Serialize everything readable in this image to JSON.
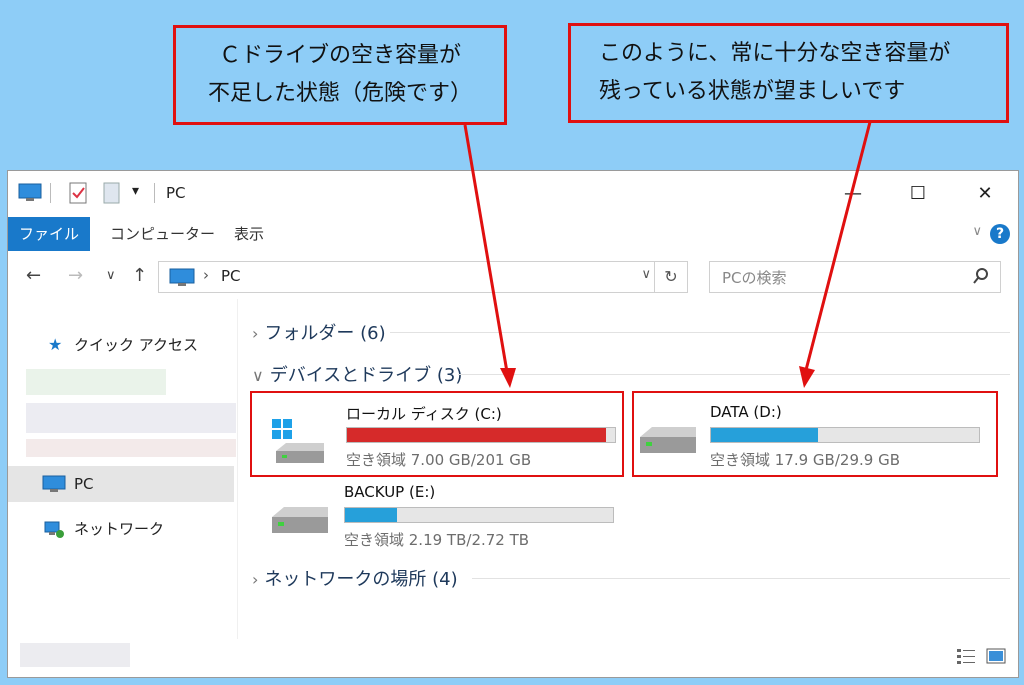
{
  "callouts": {
    "left": [
      "Ｃドライブの空き容量が",
      "不足した状態（危険です）"
    ],
    "right": [
      "このように、常に十分な空き容量が",
      "残っている状態が望ましいです"
    ]
  },
  "window": {
    "title": "PC",
    "minimize": "—",
    "maximize": "☐",
    "close": "✕"
  },
  "ribbon": {
    "tabs": [
      "ファイル",
      "コンピューター",
      "表示"
    ],
    "help": "?"
  },
  "address": {
    "path": "PC",
    "separator": "›",
    "search_placeholder": "PCの検索"
  },
  "sidebar": {
    "items": [
      {
        "label": "クイック アクセス",
        "icon": "star-icon"
      },
      {
        "label": "PC",
        "icon": "pc-icon",
        "selected": true
      },
      {
        "label": "ネットワーク",
        "icon": "network-icon"
      }
    ]
  },
  "groups": {
    "folders": "フォルダー (6)",
    "devices": "デバイスとドライブ (3)",
    "network": "ネットワークの場所 (4)"
  },
  "drives": [
    {
      "name": "ローカル ディスク (C:)",
      "free_text": "空き領域 7.00 GB/201 GB",
      "used_fraction": 0.965,
      "bar_color": "#d62a2a",
      "icon": "windows-drive-icon"
    },
    {
      "name": "DATA (D:)",
      "free_text": "空き領域 17.9 GB/29.9 GB",
      "used_fraction": 0.4,
      "bar_color": "#26a0da",
      "icon": "hdd-icon"
    },
    {
      "name": "BACKUP (E:)",
      "free_text": "空き領域 2.19 TB/2.72 TB",
      "used_fraction": 0.195,
      "bar_color": "#26a0da",
      "icon": "hdd-icon"
    }
  ],
  "colors": {
    "accent": "#1979ca",
    "highlight_border": "#e01010",
    "background": "#8ecdf7"
  }
}
